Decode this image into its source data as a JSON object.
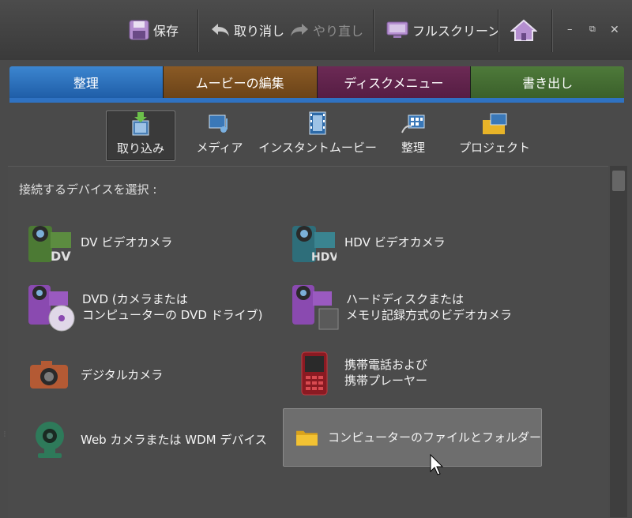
{
  "toolbar": {
    "save": "保存",
    "undo": "取り消し",
    "redo": "やり直し",
    "fullscreen": "フルスクリーン"
  },
  "tabs": [
    {
      "label": "整理",
      "color": "#2f72c2"
    },
    {
      "label": "ムービーの編集",
      "color": "#7a4f20"
    },
    {
      "label": "ディスクメニュー",
      "color": "#62244d"
    },
    {
      "label": "書き出し",
      "color": "#466e34"
    }
  ],
  "subtoolbar": {
    "items": [
      {
        "label": "取り込み",
        "icon": "import-icon",
        "active": true
      },
      {
        "label": "メディア",
        "icon": "media-icon"
      },
      {
        "label": "インスタントムービー",
        "icon": "instant-movie-icon"
      },
      {
        "label": "整理",
        "icon": "organize-icon"
      },
      {
        "label": "プロジェクト",
        "icon": "project-icon"
      }
    ]
  },
  "panel": {
    "prompt": "接続するデバイスを選択 :",
    "devices": [
      {
        "lines": [
          "DV ビデオカメラ"
        ],
        "icon": "dv-camcorder-icon"
      },
      {
        "lines": [
          "HDV ビデオカメラ"
        ],
        "icon": "hdv-camcorder-icon"
      },
      {
        "lines": [
          "DVD (カメラまたは",
          "コンピューターの DVD ドライブ)"
        ],
        "icon": "dvd-camcorder-icon"
      },
      {
        "lines": [
          "ハードディスクまたは",
          "メモリ記録方式のビデオカメラ"
        ],
        "icon": "hdd-camcorder-icon"
      },
      {
        "lines": [
          "デジタルカメラ"
        ],
        "icon": "digital-camera-icon"
      },
      {
        "lines": [
          "携帯電話および",
          "携帯プレーヤー"
        ],
        "icon": "mobile-phone-icon"
      },
      {
        "lines": [
          "Web カメラまたは WDM デバイス"
        ],
        "icon": "webcam-icon"
      },
      {
        "lines": [
          "コンピューターのファイルとフォルダー"
        ],
        "icon": "folder-icon",
        "hover": true
      }
    ]
  },
  "colors": {
    "accent": "#2f72c2",
    "background": "#4a4a4a"
  }
}
